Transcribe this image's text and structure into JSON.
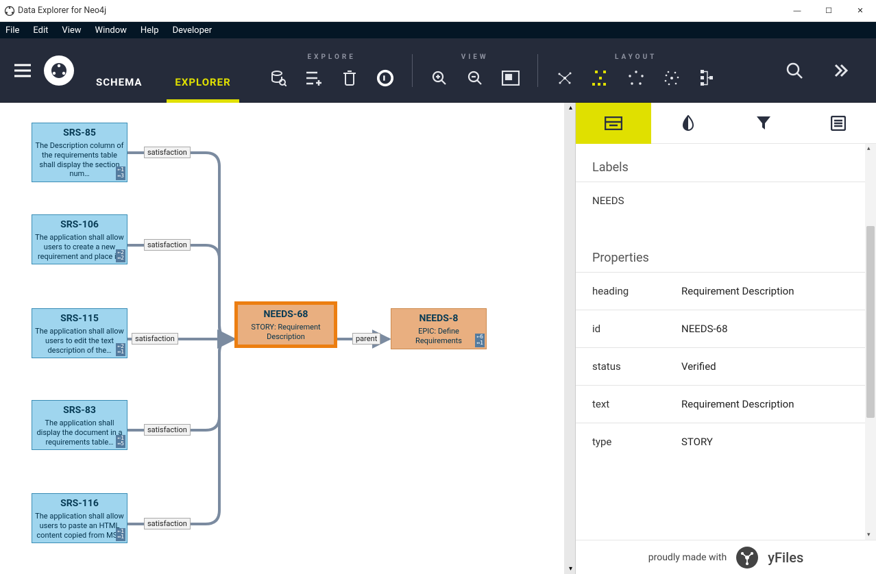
{
  "window": {
    "title": "Data Explorer for Neo4j"
  },
  "menus": [
    "File",
    "Edit",
    "View",
    "Window",
    "Help",
    "Developer"
  ],
  "tabs": {
    "schema": "SCHEMA",
    "explorer": "EXPLORER"
  },
  "toolbar": {
    "groups": {
      "explore": "EXPLORE",
      "view": "VIEW",
      "layout": "LAYOUT"
    }
  },
  "graph": {
    "nodes": [
      {
        "id": "SRS-85",
        "text": "The Description column of the requirements table shall display the section num…",
        "in": 1,
        "out": 3
      },
      {
        "id": "SRS-106",
        "text": "The application shall allow users to create a new requirement and place i…",
        "in": 2,
        "out": 2
      },
      {
        "id": "SRS-115",
        "text": "The application shall allow users to edit the text description of the…",
        "in": 2,
        "out": 1
      },
      {
        "id": "SRS-83",
        "text": "The application shall display the document in a requirements table…",
        "in": 1,
        "out": 5
      },
      {
        "id": "SRS-116",
        "text": "The application shall allow users to paste an HTML content copied from MS…",
        "in": 1,
        "out": 1
      }
    ],
    "needs68": {
      "id": "NEEDS-68",
      "text": "STORY: Requirement Description"
    },
    "needs8": {
      "id": "NEEDS-8",
      "text": "EPIC: Define Requirements",
      "in": 6,
      "out": 1
    },
    "edge_labels": [
      "satisfaction",
      "satisfaction",
      "satisfaction",
      "satisfaction",
      "satisfaction",
      "parent"
    ]
  },
  "panel": {
    "sections": {
      "labels": "Labels",
      "properties": "Properties"
    },
    "label_value": "NEEDS",
    "props": [
      {
        "k": "heading",
        "v": "Requirement Description"
      },
      {
        "k": "id",
        "v": "NEEDS-68"
      },
      {
        "k": "status",
        "v": "Verified"
      },
      {
        "k": "text",
        "v": "Requirement Description"
      },
      {
        "k": "type",
        "v": "STORY"
      }
    ],
    "footer": {
      "prefix": "proudly made with",
      "brand": "yFiles"
    }
  }
}
